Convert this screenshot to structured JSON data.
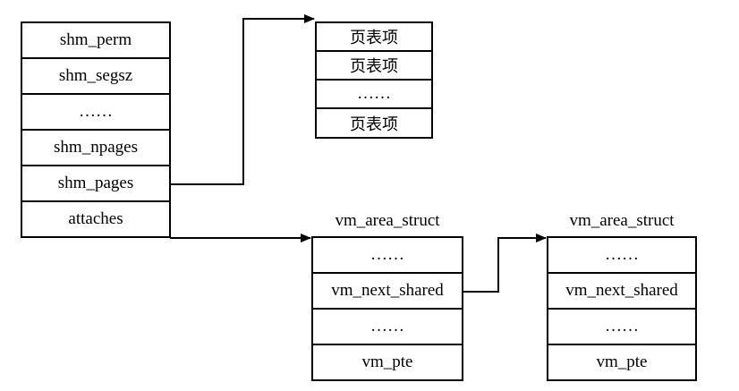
{
  "shmid_ds": {
    "fields": [
      "shm_perm",
      "shm_segsz",
      "……",
      "shm_npages",
      "shm_pages",
      "attaches"
    ]
  },
  "page_table": {
    "entries": [
      "页表项",
      "页表项",
      "……",
      "页表项"
    ]
  },
  "vm_area_1": {
    "title": "vm_area_struct",
    "fields": [
      "……",
      "vm_next_shared",
      "……",
      "vm_pte"
    ]
  },
  "vm_area_2": {
    "title": "vm_area_struct",
    "fields": [
      "……",
      "vm_next_shared",
      "……",
      "vm_pte"
    ]
  }
}
